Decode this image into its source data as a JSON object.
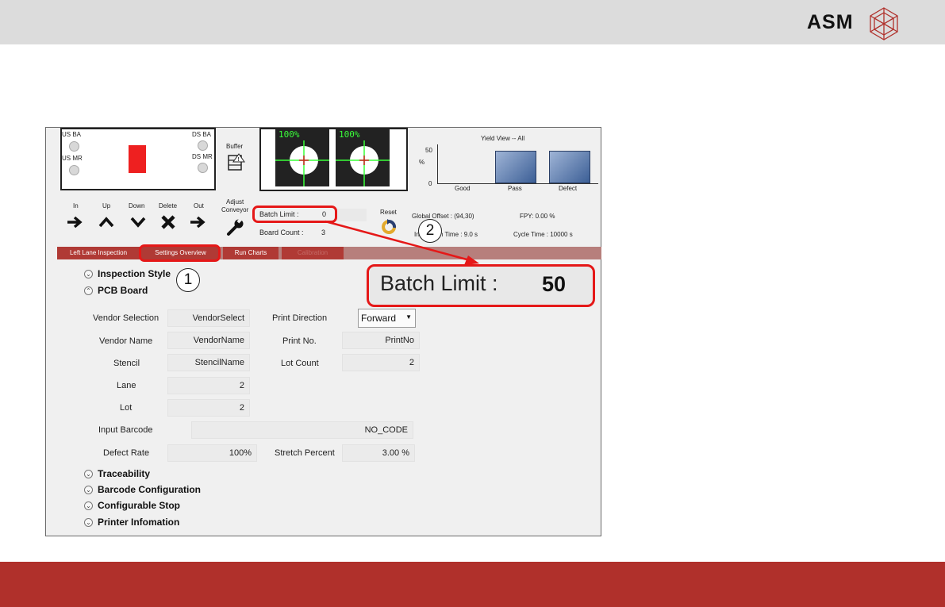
{
  "brand": {
    "name": "ASM"
  },
  "lane": {
    "us_ba": "US BA",
    "us_mr": "US MR",
    "ds_ba": "DS BA",
    "ds_mr": "DS MR",
    "buffer": "Buffer"
  },
  "camera": {
    "left_percent": "100%",
    "right_percent": "100%"
  },
  "yield_view": {
    "title": "Yield View -- All",
    "y_unit": "%",
    "y_ticks": [
      "50",
      "0"
    ],
    "categories": [
      "Good",
      "Pass",
      "Defect"
    ]
  },
  "controls": {
    "in": "In",
    "up": "Up",
    "down": "Down",
    "delete": "Delete",
    "out": "Out",
    "adjust_conveyor_1": "Adjust",
    "adjust_conveyor_2": "Conveyor",
    "reset": "Reset"
  },
  "status": {
    "batch_limit_label": "Batch Limit :",
    "batch_limit_value": "0",
    "board_count_label": "Board Count :",
    "board_count_value": "3",
    "global_offset": "Global Offset : (94,30)",
    "fpy": "FPY: 0.00   %",
    "inspection_time": "Inspection Time : 9.0 s",
    "cycle_time": "Cycle Time : 10000 s"
  },
  "tabs": [
    "Left Lane Inspection",
    "Settings Overview",
    "Run Charts",
    "Calibration"
  ],
  "sections": {
    "inspection_style": "Inspection Style",
    "pcb_board": "PCB Board",
    "traceability": "Traceability",
    "barcode_configuration": "Barcode Configuration",
    "configurable_stop": "Configurable Stop",
    "printer_information": "Printer Infomation"
  },
  "pcb": {
    "vendor_selection_label": "Vendor Selection",
    "vendor_selection_value": "VendorSelect",
    "print_direction_label": "Print Direction",
    "print_direction_value": "Forward",
    "vendor_name_label": "Vendor Name",
    "vendor_name_value": "VendorName",
    "print_no_label": "Print No.",
    "print_no_value": "PrintNo",
    "stencil_label": "Stencil",
    "stencil_value": "StencilName",
    "lot_count_label": "Lot Count",
    "lot_count_value": "2",
    "lane_label": "Lane",
    "lane_value": "2",
    "lot_label": "Lot",
    "lot_value": "2",
    "input_barcode_label": "Input Barcode",
    "input_barcode_value": "NO_CODE",
    "defect_rate_label": "Defect Rate",
    "defect_rate_value": "100%",
    "stretch_percent_label": "Stretch Percent",
    "stretch_percent_value": "3.00  %"
  },
  "zoom": {
    "label": "Batch Limit :",
    "value": "50"
  },
  "callouts": [
    "1",
    "2"
  ],
  "colors": {
    "highlight": "#e51818",
    "footer": "#b0302b",
    "tab_bar": "#b77f7c",
    "tab_active": "#b03a35"
  }
}
